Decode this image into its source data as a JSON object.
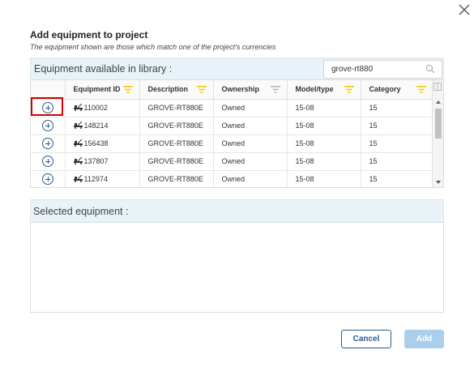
{
  "dialog": {
    "title": "Add equipment to project",
    "subtitle": "The equipment shown are those which match one of the project's currencies"
  },
  "library": {
    "header_label": "Equipment available in library :",
    "search_value": "grove-rt880"
  },
  "table": {
    "columns": [
      "Equipment ID",
      "Description",
      "Ownership",
      "Model/type",
      "Category"
    ],
    "rows": [
      {
        "id": "110002",
        "description": "GROVE-RT880E",
        "ownership": "Owned",
        "model": "15-08",
        "category": "15"
      },
      {
        "id": "148214",
        "description": "GROVE-RT880E",
        "ownership": "Owned",
        "model": "15-08",
        "category": "15"
      },
      {
        "id": "156438",
        "description": "GROVE-RT880E",
        "ownership": "Owned",
        "model": "15-08",
        "category": "15"
      },
      {
        "id": "137807",
        "description": "GROVE-RT880E",
        "ownership": "Owned",
        "model": "15-08",
        "category": "15"
      },
      {
        "id": "112974",
        "description": "GROVE-RT880E",
        "ownership": "Owned",
        "model": "15-08",
        "category": "15"
      }
    ]
  },
  "selected": {
    "header_label": "Selected equipment :"
  },
  "buttons": {
    "cancel": "Cancel",
    "add": "Add"
  },
  "colors": {
    "accent": "#2b5b92",
    "filter_active": "#f5c400",
    "panel_header": "#e7f3f8",
    "add_disabled": "#a9cfec",
    "highlight": "#d40000"
  }
}
